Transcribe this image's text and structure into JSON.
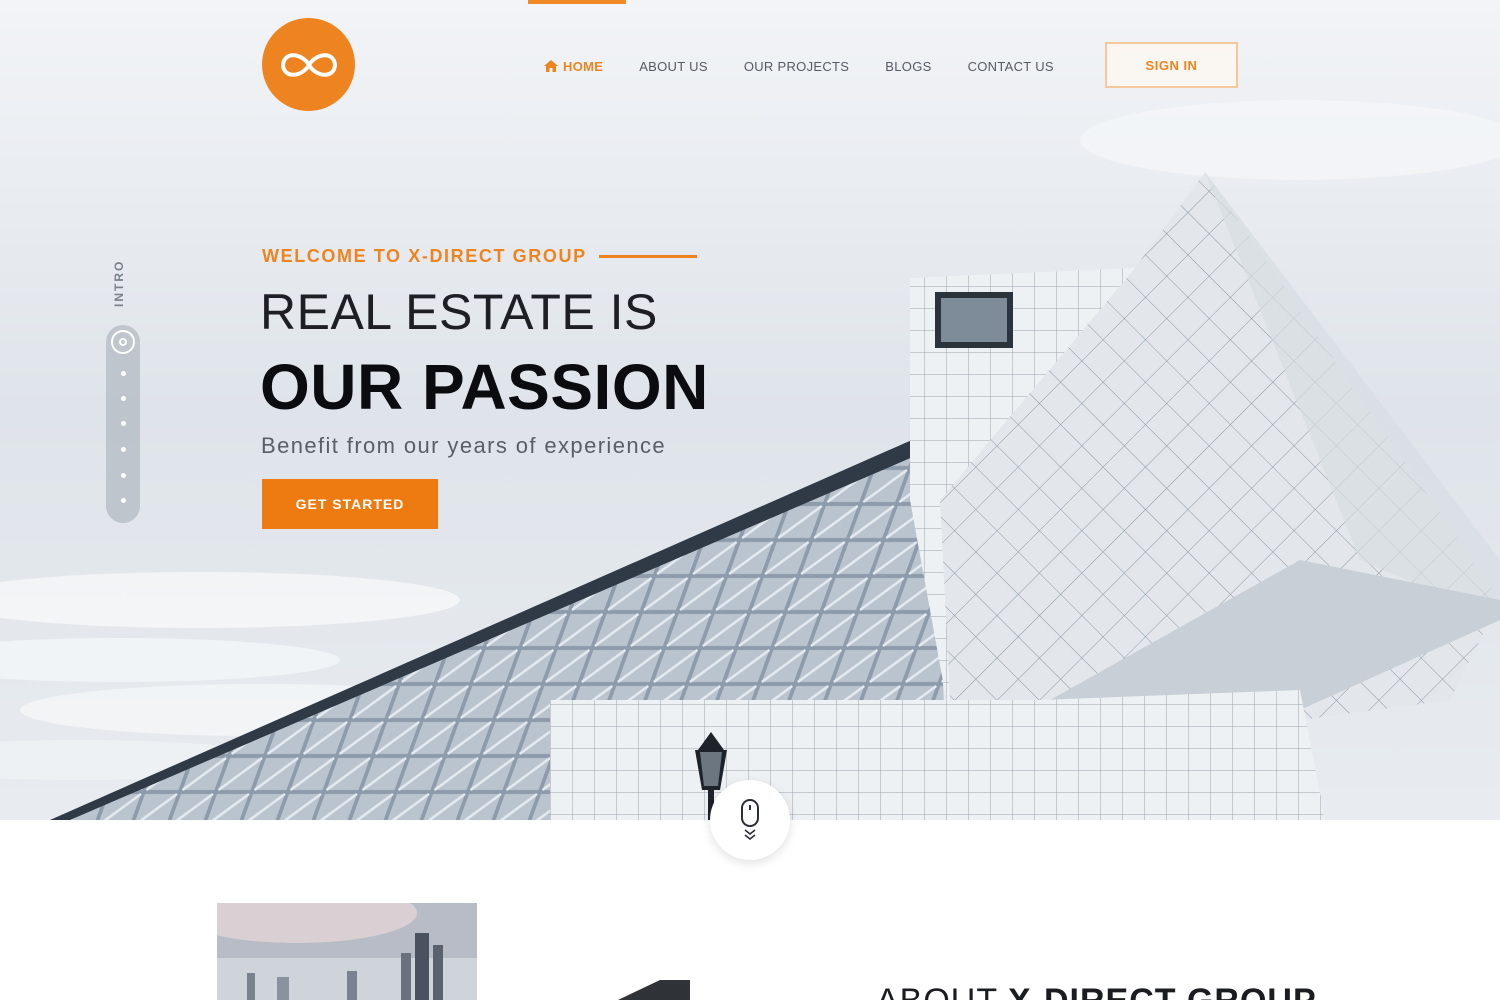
{
  "header": {
    "nav": [
      {
        "label": "HOME",
        "active": true
      },
      {
        "label": "ABOUT US",
        "active": false
      },
      {
        "label": "OUR PROJECTS",
        "active": false
      },
      {
        "label": "BLOGS",
        "active": false
      },
      {
        "label": "CONTACT US",
        "active": false
      }
    ],
    "signin_label": "SIGN IN"
  },
  "side_nav": {
    "label": "INTRO"
  },
  "hero": {
    "kicker": "WELCOME TO X-DIRECT GROUP",
    "headline_light": "REAL ESTATE IS",
    "headline_bold": "OUR PASSION",
    "subline": "Benefit from our years of experience",
    "cta_label": "GET STARTED"
  },
  "about": {
    "title_light": "ABOUT",
    "title_bold": "X-DIRECT GROUP"
  },
  "colors": {
    "accent": "#ee8420",
    "text_dark": "#0b0c10",
    "text_muted": "#5a5e66"
  },
  "icons": [
    "infinity-logo-icon",
    "home-icon",
    "mouse-scroll-icon"
  ]
}
